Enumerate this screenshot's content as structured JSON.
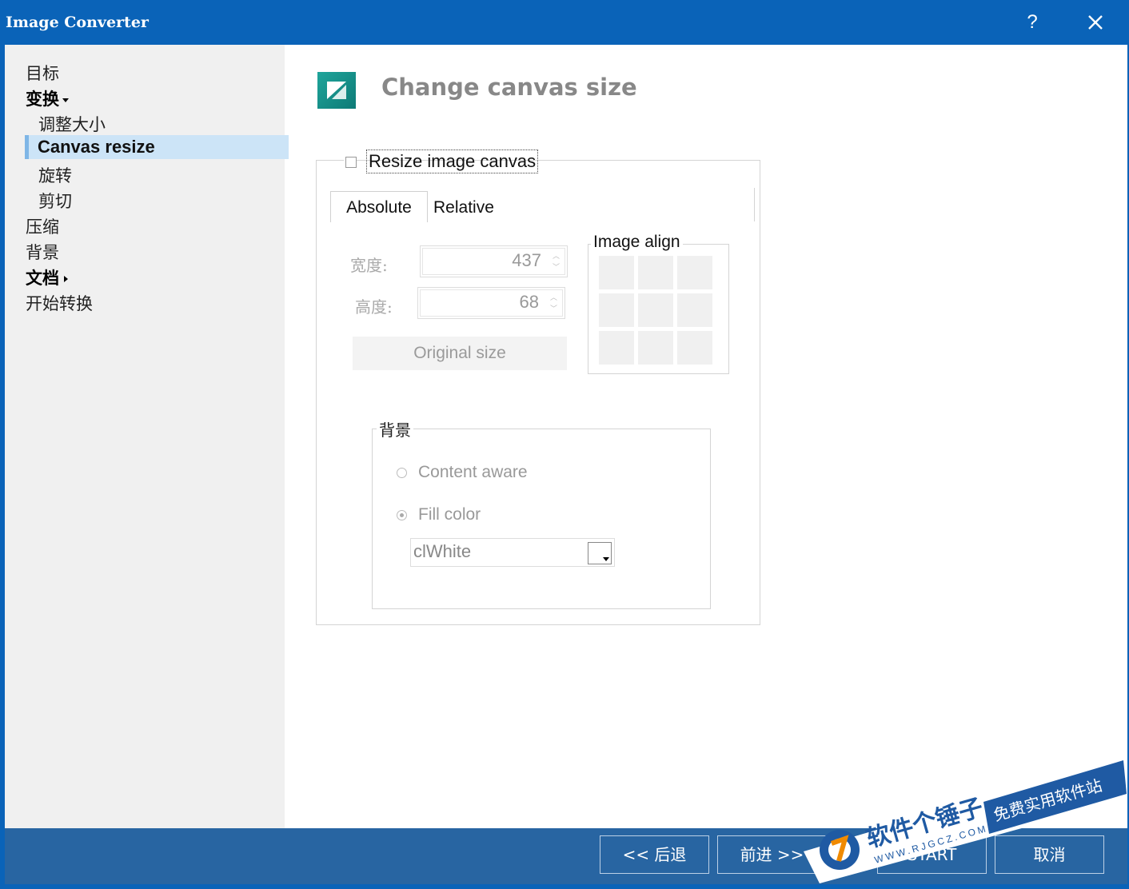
{
  "window": {
    "title": "Image Converter",
    "help_label": "?"
  },
  "sidebar": {
    "items": [
      {
        "label": "目标"
      },
      {
        "label": "变换"
      },
      {
        "label": "调整大小"
      },
      {
        "label": "Canvas resize"
      },
      {
        "label": "旋转"
      },
      {
        "label": "剪切"
      },
      {
        "label": "压缩"
      },
      {
        "label": "背景"
      },
      {
        "label": "文档"
      },
      {
        "label": "开始转换"
      }
    ],
    "selected": "Canvas resize"
  },
  "header": {
    "title": "Change canvas size",
    "icon": "canvas-resize-icon",
    "icon_color": "#1a9c94"
  },
  "resize": {
    "checkbox_label": "Resize image canvas",
    "checked": false,
    "tabs": [
      {
        "label": "Absolute"
      },
      {
        "label": "Relative"
      }
    ],
    "active_tab": "Absolute",
    "width_label": "宽度:",
    "width_value": "437",
    "height_label": "高度:",
    "height_value": "68",
    "original_size_label": "Original size",
    "image_align_label": "Image align"
  },
  "background": {
    "group_label": "背景",
    "options": [
      {
        "label": "Content aware",
        "selected": false
      },
      {
        "label": "Fill color",
        "selected": true
      }
    ],
    "color_value": "clWhite"
  },
  "footer": {
    "back_label": "<< 后退",
    "next_label": "前进 >>",
    "start_label": "START",
    "cancel_label": "取消"
  },
  "watermark": {
    "brand": "软件个锤子",
    "url": "WWW.RJGCZ.COM",
    "slogan": "免费实用软件站"
  },
  "colors": {
    "titlebar": "#0a63b8",
    "footer": "#2865a2",
    "selection": "#cce4f7"
  }
}
